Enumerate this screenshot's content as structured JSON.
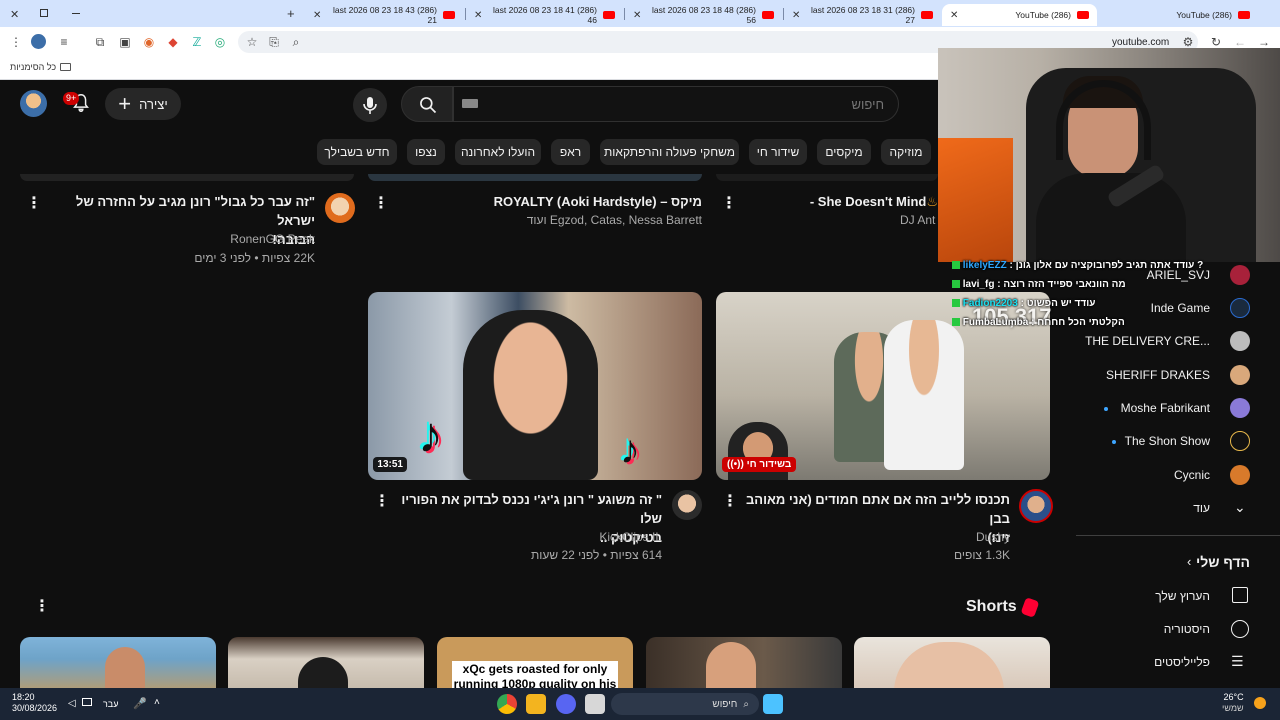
{
  "browser": {
    "tabs": [
      {
        "title": "(286) last 2026 08 23 18 43 21"
      },
      {
        "title": "(286) last 2026 08 23 18 41 46"
      },
      {
        "title": "(286) last 2026 08 23 18 48 56"
      },
      {
        "title": "(286) last 2026 08 23 18 31 27"
      },
      {
        "title": "(286) YouTube"
      },
      {
        "title": "(286) YouTube"
      }
    ],
    "url": "youtube.com",
    "bookmarks_all_label": "כל הסימניות"
  },
  "yt": {
    "create_label": "יצירה",
    "notif_count": "9+",
    "search_placeholder": "חיפוש",
    "chips": [
      "מוזיקה",
      "מיקסים",
      "שידור חי",
      "משחקי פעולה והרפתקאות",
      "ראפ",
      "הועלו לאחרונה",
      "נצפו",
      "חדש בשבילך"
    ]
  },
  "videos_row1": [
    {
      "title_line1": "\"זה עבר כל גבול\" רונן מגיב על החזרה של ישראל",
      "title_line2": "הבובה!",
      "channel": "RonenGG Peak",
      "meta": "22K צפיות • לפני 3 ימים"
    },
    {
      "title_line1": "מיקס – ROYALTY (Aoki Hardstyle)",
      "channel": "Egzod, Catas, Nessa Barrett ועוד"
    },
    {
      "title_line1": "She Doesn't Mind -",
      "channel": "DJ Ant"
    }
  ],
  "videos_row2": [
    {
      "title_line1": "\" זה משוגע \" רונן ג'יג'י נכנס לבדוק את הפוריו שלו",
      "title_line2": "בטיקטוק ..",
      "channel": "KickClips IL",
      "meta": "614 צפיות • לפני 22 שעות",
      "duration": "13:51"
    },
    {
      "title_line1": "תכנסו ללייב הזה אם אתם חמודים (אני מאוהב בבן",
      "title_line2": "זינו)",
      "channel": "Dushy",
      "meta": "1.3K צופים",
      "live_label": "בשידור חי"
    }
  ],
  "sidebar": {
    "channels": [
      {
        "name": "ARIEL_SVJ"
      },
      {
        "name": "Inde Game"
      },
      {
        "name": "THE DELIVERY CRE..."
      },
      {
        "name": "SHERIFF DRAKES"
      },
      {
        "name": "Moshe Fabrikant"
      },
      {
        "name": "The Shon Show"
      },
      {
        "name": "Cycnic"
      }
    ],
    "more_label": "עוד",
    "you_label": "הדף שלי",
    "your_channel": "הערוץ שלך",
    "history": "היסטוריה",
    "playlists": "פלייליסטים"
  },
  "shorts": {
    "label": "Shorts",
    "card3_caption_line1": "xQc gets roasted for only",
    "card3_caption_line2": "running 1080p quality on his"
  },
  "stream_overlay": {
    "viewer_count": "105,317",
    "chat": [
      {
        "user": "likelyEZZ",
        "text": "? עודד אתה תגיב לפרובוקציה עם אלון גונן"
      },
      {
        "user": "lavi_fg",
        "text": "מה הוונאבי ספייד הזה רוצה"
      },
      {
        "user": "Fadion2203",
        "text": "עודד יש הפשוט"
      },
      {
        "user": "FumbaLumba",
        "text": "הקלטתי הכל חחחח"
      }
    ]
  },
  "taskbar": {
    "time": "18:20",
    "date": "30/08/2026",
    "lang": "עבר",
    "search_placeholder": "חיפוש",
    "weather_temp": "26°C",
    "weather_label": "שמשי"
  }
}
